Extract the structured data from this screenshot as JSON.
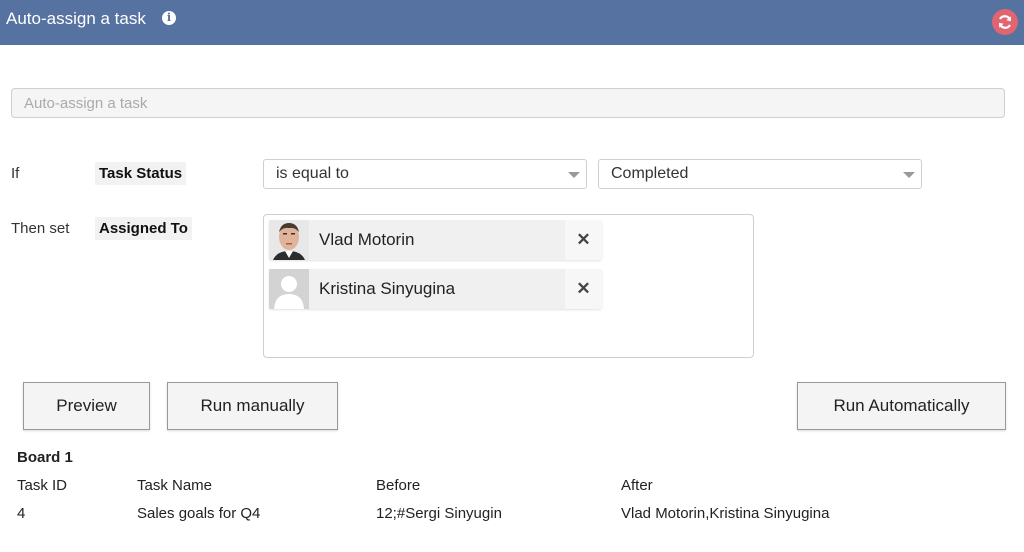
{
  "header": {
    "title": "Auto-assign a task",
    "info_icon": "info-icon",
    "refresh_icon": "refresh-icon",
    "color": "#5572a0",
    "refresh_color": "#e06570"
  },
  "name_field": {
    "placeholder": "Auto-assign a task",
    "value": ""
  },
  "condition": {
    "label": "If",
    "field": "Task Status",
    "operator": "is equal to",
    "value": "Completed"
  },
  "action": {
    "label": "Then set",
    "field": "Assigned To",
    "people": [
      {
        "name": "Vlad Motorin",
        "avatar": "photo"
      },
      {
        "name": "Kristina Sinyugina",
        "avatar": "placeholder"
      }
    ],
    "remove_icon": "close-icon"
  },
  "buttons": {
    "preview": "Preview",
    "run_manually": "Run manually",
    "run_automatically": "Run Automatically"
  },
  "results": {
    "board": "Board 1",
    "columns": [
      "Task ID",
      "Task Name",
      "Before",
      "After"
    ],
    "rows": [
      [
        "4",
        "Sales goals for Q4",
        "12;#Sergi Sinyugin",
        "Vlad Motorin,Kristina Sinyugina"
      ]
    ]
  }
}
